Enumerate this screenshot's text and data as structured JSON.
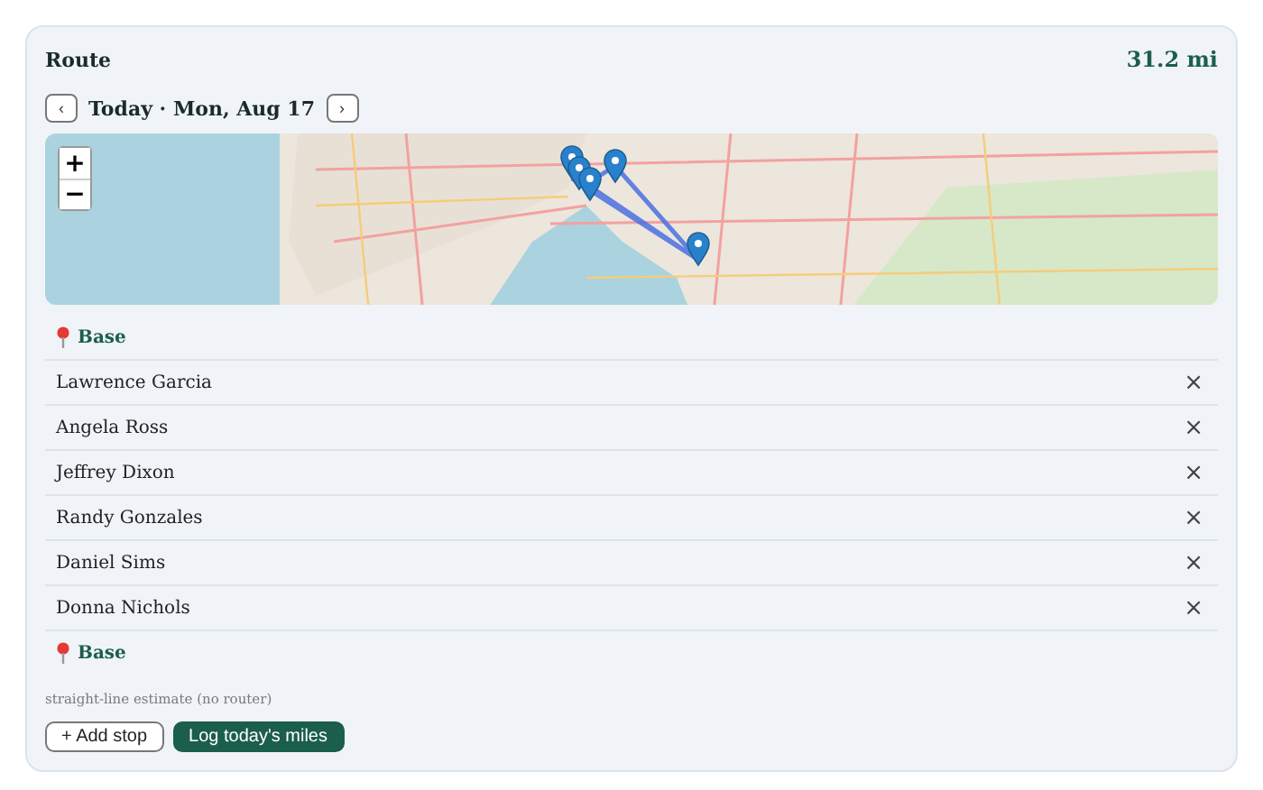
{
  "header": {
    "title": "Route",
    "distance": "31.2 mi"
  },
  "date_nav": {
    "prev": "‹",
    "label": "Today · Mon, Aug 17",
    "next": "›"
  },
  "map": {
    "zoom_in": "+",
    "zoom_out": "−"
  },
  "stops": [
    {
      "kind": "base",
      "name": "Base"
    },
    {
      "kind": "stop",
      "name": "Lawrence Garcia",
      "remove": "×"
    },
    {
      "kind": "stop",
      "name": "Angela Ross",
      "remove": "×"
    },
    {
      "kind": "stop",
      "name": "Jeffrey Dixon",
      "remove": "×"
    },
    {
      "kind": "stop",
      "name": "Randy Gonzales",
      "remove": "×"
    },
    {
      "kind": "stop",
      "name": "Daniel Sims",
      "remove": "×"
    },
    {
      "kind": "stop",
      "name": "Donna Nichols",
      "remove": "×"
    },
    {
      "kind": "base",
      "name": "Base"
    }
  ],
  "note": "straight-line estimate (no router)",
  "buttons": [
    {
      "kind": "secondary",
      "label": "+ Add stop"
    },
    {
      "kind": "primary",
      "label": "Log today's miles"
    }
  ]
}
